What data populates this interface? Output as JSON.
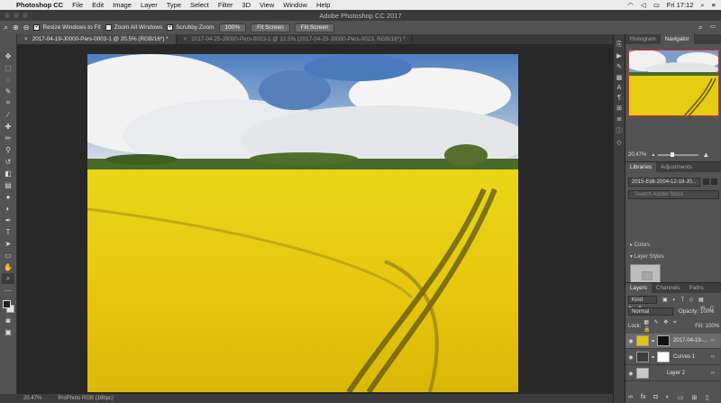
{
  "menubar": {
    "app_name": "Photoshop CC",
    "items": [
      "File",
      "Edit",
      "Image",
      "Layer",
      "Type",
      "Select",
      "Filter",
      "3D",
      "View",
      "Window",
      "Help"
    ],
    "clock": "Fri 17:12"
  },
  "window": {
    "title": "Adobe Photoshop CC 2017"
  },
  "options": {
    "resize_windows": "Resize Windows to Fit",
    "zoom_all": "Zoom All Windows",
    "scrubby_zoom": "Scrubby Zoom",
    "btn_100": "100%",
    "btn_fit": "Fit Screen",
    "btn_fill": "Fill Screen"
  },
  "tabs": [
    {
      "label": "2017-04-19-J0000-Pers-0003-1 @ 20.5% (RGB/16*) *",
      "active": true
    },
    {
      "label": "2017-04-25-J0000-Pers-0023-1 @ 12.5% (2017-04-25-J0000-Pers-0023, RGB/16*) *",
      "active": false
    }
  ],
  "status": {
    "zoom": "20.47%",
    "profile": "ProPhoto RGB (16bpc)"
  },
  "panels": {
    "top_tabs": [
      "Histogram",
      "Navigator"
    ],
    "navigator_zoom": "20.47%",
    "lib_tabs": [
      "Libraries",
      "Adjustments"
    ],
    "library_name": "2015-Edit-2004-12-18-J0...",
    "library_search_placeholder": "Search Adobe Stock",
    "group_colors": "Colors",
    "group_layer_styles": "Layer Styles",
    "layer_tabs": [
      "Layers",
      "Channels",
      "Paths"
    ],
    "kind_label": "Kind",
    "blend_mode": "Normal",
    "opacity_label": "Opacity:",
    "opacity_value": "100%",
    "lock_label": "Lock:",
    "fill_label": "Fill:",
    "fill_value": "100%",
    "layers": [
      {
        "name": "2017-04-19-...",
        "type": "smart"
      },
      {
        "name": "Curves 1",
        "type": "adjustment"
      },
      {
        "name": "Layer 2",
        "type": "pixel"
      }
    ]
  },
  "colors": {
    "foreground": "#2b2020",
    "background": "#e8e3e3",
    "nav_highlight": "#e0291f",
    "field": "#f2d21a"
  }
}
